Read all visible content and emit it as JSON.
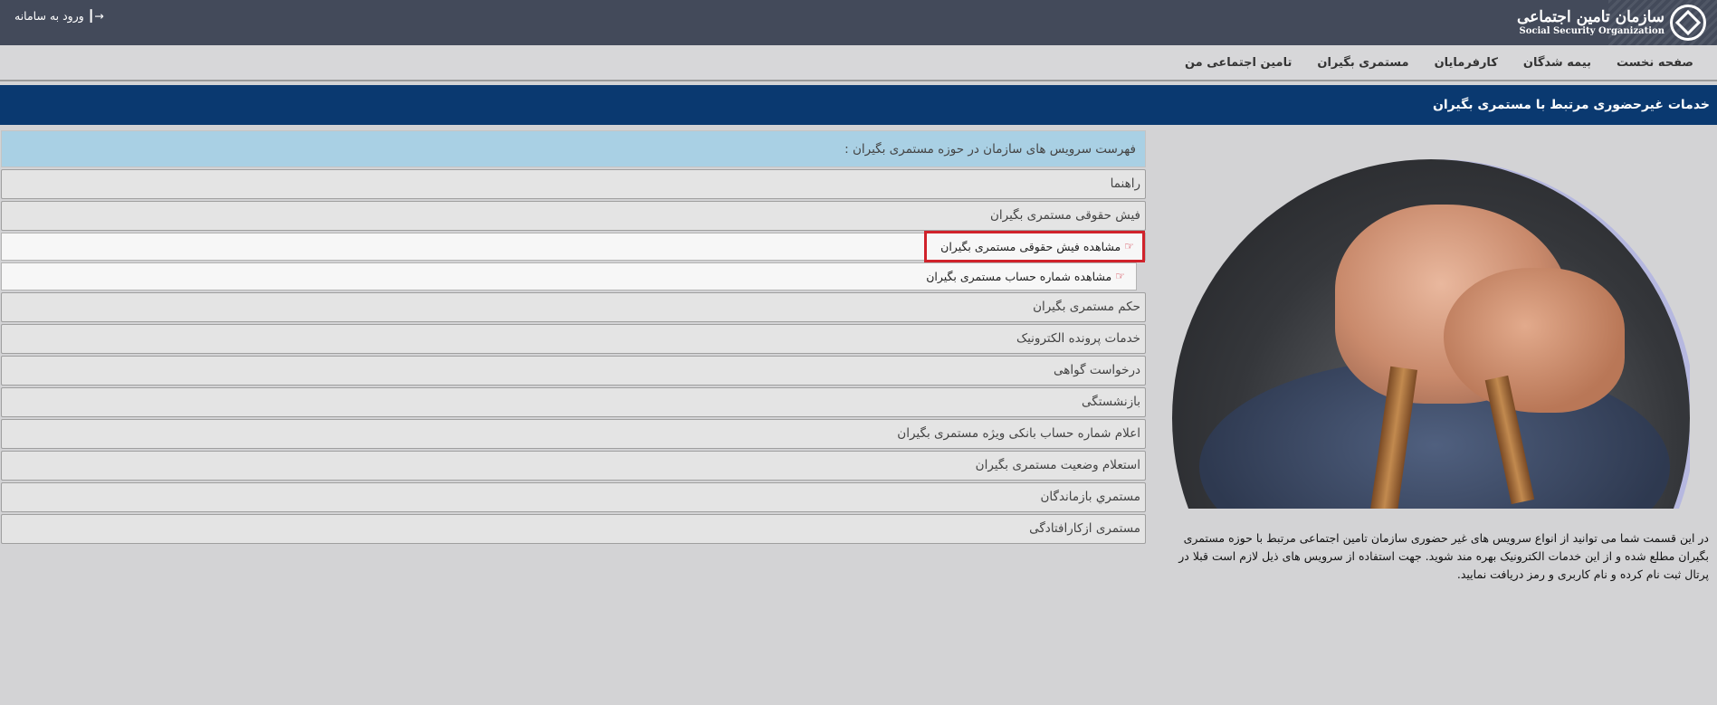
{
  "header": {
    "logo_fa": "سازمان تامین اجتماعی",
    "logo_en": "Social Security Organization",
    "login_label": "ورود به سامانه"
  },
  "nav": {
    "items": [
      "صفحه نخست",
      "بیمه شدگان",
      "کارفرمایان",
      "مستمری بگیران",
      "تامین اجتماعی من"
    ]
  },
  "banner": {
    "title": "خدمات غیرحضوری مرتبط با مستمری بگیران"
  },
  "services": {
    "header": "فهرست سرویس های سازمان در حوزه مستمری بگیران :",
    "items": [
      "راهنما",
      "فیش حقوقی مستمری بگیران",
      "حکم مستمری بگیران",
      "خدمات پرونده الکترونیک",
      "درخواست گواهی",
      "بازنشستگی",
      "اعلام شماره حساب بانکی ویژه مستمری بگیران",
      "استعلام وضعیت مستمری بگیران",
      "مستمري بازماندگان",
      "مستمری ازکارافتادگی"
    ],
    "sub_items": [
      "مشاهده فیش حقوقی مستمری بگیران",
      "مشاهده شماره حساب مستمری بگیران"
    ]
  },
  "description": "در این قسمت شما می توانید از انواع سرویس های غیر حضوری سازمان تامین اجتماعی مرتبط با حوزه مستمری بگیران مطلع شده و از این خدمات الکترونیک بهره مند شوید. جهت استفاده از سرویس های ذیل لازم است قبلا در پرتال ثبت نام کرده و نام کاربری و رمز دریافت نمایید."
}
